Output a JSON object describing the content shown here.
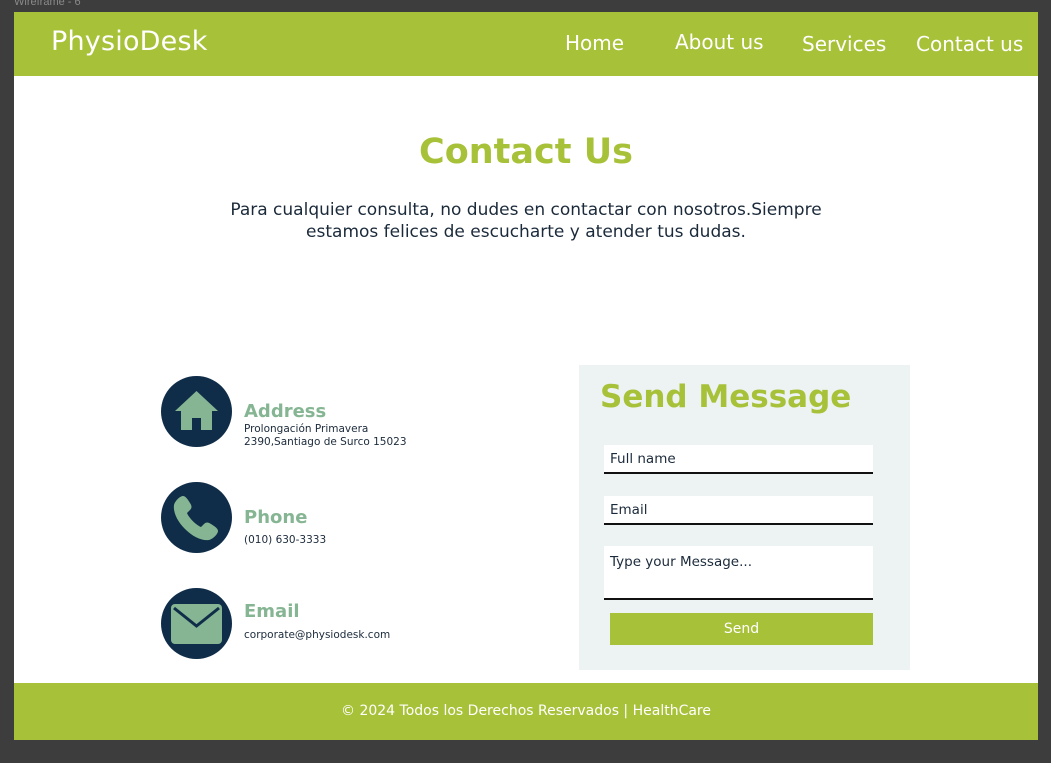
{
  "frame": {
    "label": "Wireframe - 6"
  },
  "brand": {
    "name": "PhysioDesk"
  },
  "nav": {
    "items": [
      {
        "label": "Home"
      },
      {
        "label": "About us"
      },
      {
        "label": "Services"
      },
      {
        "label": "Contact us"
      }
    ]
  },
  "hero": {
    "title": "Contact Us",
    "text": "Para cualquier consulta, no dudes en contactar con nosotros.Siempre estamos felices de escucharte y atender tus dudas."
  },
  "contact_info": {
    "address": {
      "title": "Address",
      "line1": "Prolongación Primavera",
      "line2": "2390,Santiago de Surco 15023",
      "icon": "home-icon"
    },
    "phone": {
      "title": "Phone",
      "value": "(010) 630-3333",
      "icon": "phone-icon"
    },
    "email": {
      "title": "Email",
      "value": "corporate@physiodesk.com",
      "icon": "mail-icon"
    }
  },
  "form": {
    "title": "Send Message",
    "fullname_placeholder": "Full name",
    "email_placeholder": "Email",
    "message_placeholder": "Type your Message...",
    "send_label": "Send"
  },
  "footer": {
    "text": "© 2024 Todos los Derechos Reservados | HealthCare"
  },
  "colors": {
    "accent": "#a7c139",
    "navy": "#0f2d48",
    "sage": "#85b592",
    "panel": "#edf2f2",
    "text": "#1b2a3a"
  }
}
